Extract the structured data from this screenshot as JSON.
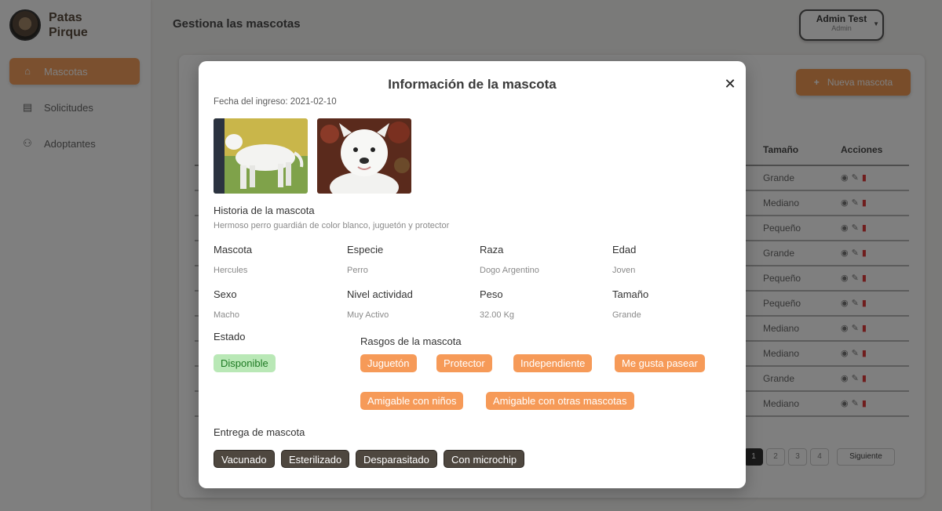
{
  "app": {
    "brand": "Patas Pirque",
    "page_title": "Gestiona las mascotas",
    "user": {
      "name": "Admin Test",
      "role": "Admin"
    },
    "nav": [
      {
        "label": "Mascotas",
        "icon": "dog-house-icon"
      },
      {
        "label": "Solicitudes",
        "icon": "document-icon"
      },
      {
        "label": "Adoptantes",
        "icon": "users-icon"
      }
    ],
    "new_button": "Nueva mascota",
    "table": {
      "headers": {
        "size": "Tamaño",
        "actions": "Acciones"
      },
      "sizes": [
        "Grande",
        "Mediano",
        "Pequeño",
        "Grande",
        "Pequeño",
        "Pequeño",
        "Mediano",
        "Mediano",
        "Grande",
        "Mediano"
      ]
    },
    "pagination": {
      "pages": [
        "1",
        "2",
        "3",
        "4"
      ],
      "next": "Siguiente"
    }
  },
  "modal": {
    "title": "Información de la mascota",
    "close_icon": "close-icon",
    "intake_date": "Fecha del ingreso: 2021-02-10",
    "photos": [
      "dog-standing-photo",
      "dog-portrait-photo"
    ],
    "story": {
      "label": "Historia de la mascota",
      "value": "Hermoso perro guardián de color blanco, juguetón y protector"
    },
    "fields": [
      {
        "label": "Mascota",
        "value": "Hercules"
      },
      {
        "label": "Especie",
        "value": "Perro"
      },
      {
        "label": "Raza",
        "value": "Dogo Argentino"
      },
      {
        "label": "Edad",
        "value": "Joven"
      },
      {
        "label": "Sexo",
        "value": "Macho"
      },
      {
        "label": "Nivel actividad",
        "value": "Muy Activo"
      },
      {
        "label": "Peso",
        "value": "32.00 Kg"
      },
      {
        "label": "Tamaño",
        "value": "Grande"
      }
    ],
    "status": {
      "label": "Estado",
      "value": "Disponible"
    },
    "traits": {
      "label": "Rasgos de la mascota",
      "items": [
        "Juguetón",
        "Protector",
        "Independiente",
        "Me gusta pasear",
        "Amigable con niños",
        "Amigable con otras mascotas"
      ]
    },
    "delivery": {
      "label": "Entrega de mascota",
      "items": [
        "Vacunado",
        "Esterilizado",
        "Desparasitado",
        "Con microchip"
      ]
    }
  },
  "colors": {
    "accent": "#f69a58",
    "status_bg": "#b9e8b6",
    "status_text": "#1e7a23",
    "delivery_bg": "#4e473f"
  }
}
